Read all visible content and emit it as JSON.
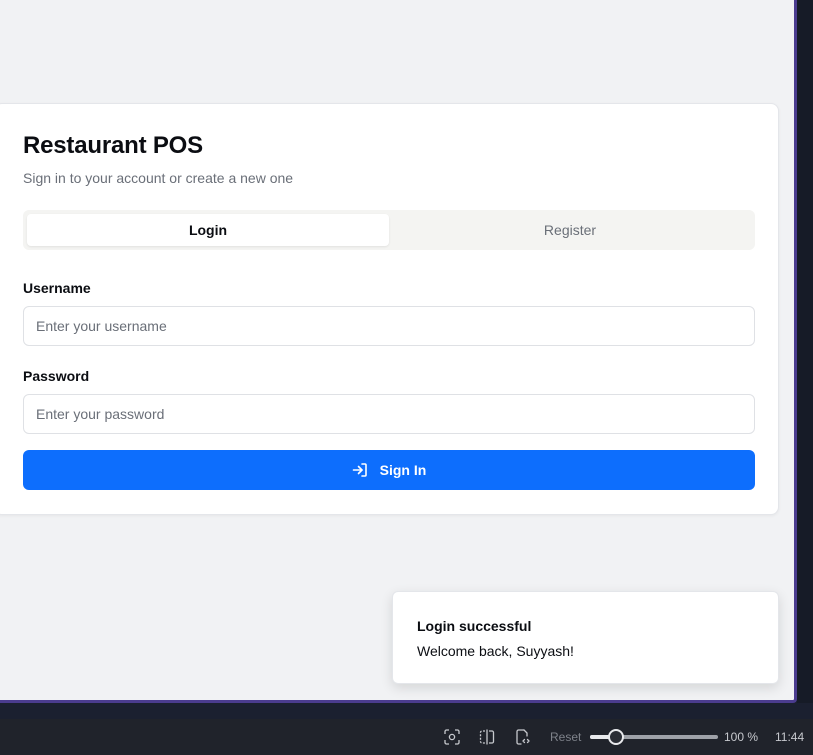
{
  "login": {
    "title": "Restaurant POS",
    "subtitle": "Sign in to your account or create a new one",
    "tabs": [
      {
        "label": "Login",
        "active": true
      },
      {
        "label": "Register",
        "active": false
      }
    ],
    "username_label": "Username",
    "username_placeholder": "Enter your username",
    "username_value": "",
    "password_label": "Password",
    "password_placeholder": "Enter your password",
    "password_value": "",
    "signin_label": "Sign In",
    "signin_icon": "sign-in-arrow-icon",
    "accent_color": "#0d6efd"
  },
  "toast": {
    "title": "Login successful",
    "message": "Welcome back, Suyyash!"
  },
  "taskbar": {
    "icons": [
      "screenshot-icon",
      "split-view-icon",
      "responsive-code-icon"
    ],
    "reset_label": "Reset",
    "zoom_level": "100 %",
    "zoom_fraction": 0.2,
    "time": "11:44"
  }
}
